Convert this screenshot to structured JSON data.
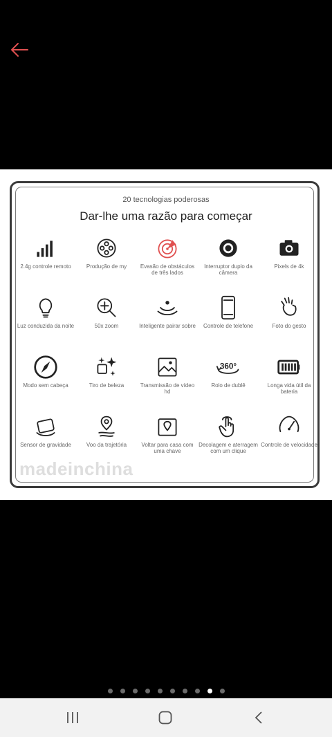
{
  "colors": {
    "accent": "#e05050",
    "background": "#000000",
    "card": "#ffffff"
  },
  "header": {
    "back_icon": "arrow-left-icon"
  },
  "card": {
    "subtitle": "20 tecnologias poderosas",
    "title": "Dar-lhe uma razão para começar",
    "features": [
      {
        "label": "2.4g controle remoto",
        "icon": "signal-bars-icon"
      },
      {
        "label": "Produção de my",
        "icon": "film-reel-icon"
      },
      {
        "label": "Evasão de obstáculos de três lados",
        "icon": "radar-icon"
      },
      {
        "label": "Interruptor duplo da câmera",
        "icon": "camera-lens-icon"
      },
      {
        "label": "Pixels de 4k",
        "icon": "camera-icon"
      },
      {
        "label": "Luz conduzida da noite",
        "icon": "light-bulb-icon"
      },
      {
        "label": "50x zoom",
        "icon": "zoom-in-icon"
      },
      {
        "label": "Inteligente pairar sobre",
        "icon": "hover-icon"
      },
      {
        "label": "Controle de telefone",
        "icon": "smartphone-icon"
      },
      {
        "label": "Foto do gesto",
        "icon": "gesture-hand-icon"
      },
      {
        "label": "Modo sem cabeça",
        "icon": "compass-icon"
      },
      {
        "label": "Tiro de beleza",
        "icon": "sparkle-icon"
      },
      {
        "label": "Transmissão de vídeo hd",
        "icon": "image-icon"
      },
      {
        "label": "Rolo de dublê",
        "icon": "rotate-360-icon"
      },
      {
        "label": "Longa vida útil da bateria",
        "icon": "battery-icon"
      },
      {
        "label": "Sensor de gravidade",
        "icon": "phone-tilt-icon"
      },
      {
        "label": "Voo da trajetória",
        "icon": "route-pin-icon"
      },
      {
        "label": "Voltar para casa com uma chave",
        "icon": "map-pin-icon"
      },
      {
        "label": "Decolagem e aterragem com um clique",
        "icon": "tap-hand-icon"
      },
      {
        "label": "Controle de velocidade",
        "icon": "speedometer-icon"
      }
    ],
    "watermark": "madeinchina"
  },
  "pager": {
    "count": 10,
    "active_index": 8
  },
  "navbar": {
    "recent_icon": "recent-apps-icon",
    "home_icon": "home-icon",
    "back_icon": "back-chevron-icon"
  }
}
